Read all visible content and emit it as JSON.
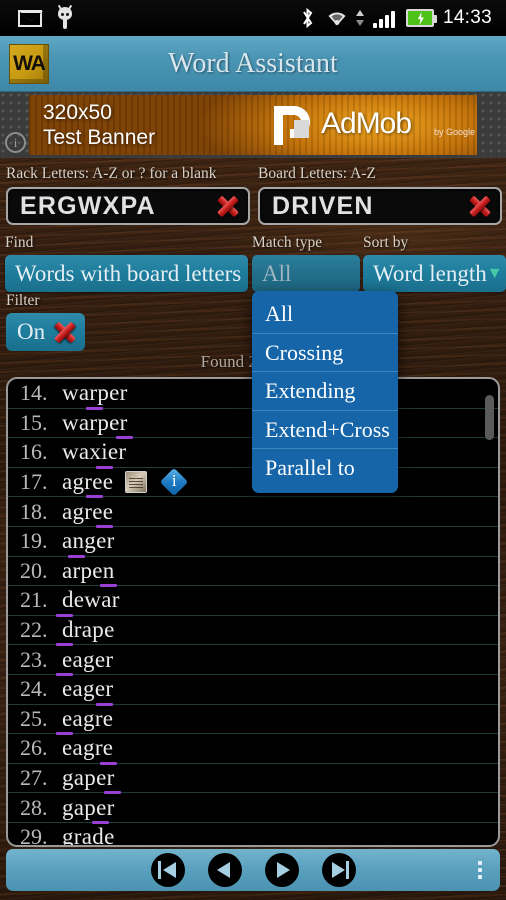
{
  "statusbar": {
    "time": "14:33",
    "icons": [
      "mail-icon",
      "android-bug-icon",
      "bluetooth-icon",
      "wifi-icon",
      "sync-icon",
      "signal-icon",
      "battery-charging-icon"
    ]
  },
  "titlebar": {
    "app_icon_text": "WA",
    "title": "Word Assistant"
  },
  "ad": {
    "line1": "320x50",
    "line2": "Test Banner",
    "brand": "AdMob",
    "by": "by Google",
    "info_glyph": "i"
  },
  "rack": {
    "label": "Rack Letters: A-Z or ? for a blank",
    "value": "ERGWXPA",
    "clear": "clear-icon"
  },
  "board": {
    "label": "Board Letters: A-Z",
    "value": "DRIVEN",
    "clear": "clear-icon"
  },
  "find": {
    "label": "Find",
    "value": "Words with board letters"
  },
  "match_type": {
    "label": "Match type",
    "value": "All",
    "options": [
      "All",
      "Crossing",
      "Extending",
      "Extend+Cross",
      "Parallel to"
    ],
    "expanded": true
  },
  "sort_by": {
    "label": "Sort by",
    "value": "Word length",
    "caret": "▼"
  },
  "filter": {
    "label": "Filter",
    "value": "On",
    "clear": "clear-icon"
  },
  "results": {
    "found_text": "Found 269 m",
    "rows": [
      {
        "num": "14.",
        "word": "warper",
        "mark": 78
      },
      {
        "num": "15.",
        "word": "warper",
        "mark": 108
      },
      {
        "num": "16.",
        "word": "waxier",
        "mark": 88
      },
      {
        "num": "17.",
        "word": "agree",
        "mark": 78,
        "book": true,
        "info": true
      },
      {
        "num": "18.",
        "word": "agree",
        "mark": 88
      },
      {
        "num": "19.",
        "word": "anger",
        "mark": 60
      },
      {
        "num": "20.",
        "word": "arpen",
        "mark": 92
      },
      {
        "num": "21.",
        "word": "dewar",
        "mark": 48
      },
      {
        "num": "22.",
        "word": "drape",
        "mark": 48
      },
      {
        "num": "23.",
        "word": "eager",
        "mark": 48
      },
      {
        "num": "24.",
        "word": "eager",
        "mark": 88
      },
      {
        "num": "25.",
        "word": "eagre",
        "mark": 48
      },
      {
        "num": "26.",
        "word": "eagre",
        "mark": 92
      },
      {
        "num": "27.",
        "word": "gaper",
        "mark": 96
      },
      {
        "num": "28.",
        "word": "gaper",
        "mark": 84
      },
      {
        "num": "29.",
        "word": "grade",
        "mark": 0
      }
    ]
  },
  "nav": {
    "first": "first-page-button",
    "prev": "previous-page-button",
    "next": "next-page-button",
    "last": "last-page-button",
    "overflow": "overflow-menu-button"
  },
  "colors": {
    "accent": "#1f7e9e",
    "dropdown": "#1565a8",
    "titlebar": "#4b95b4",
    "mark": "#9b3fd4",
    "battery": "#4fc21a"
  }
}
